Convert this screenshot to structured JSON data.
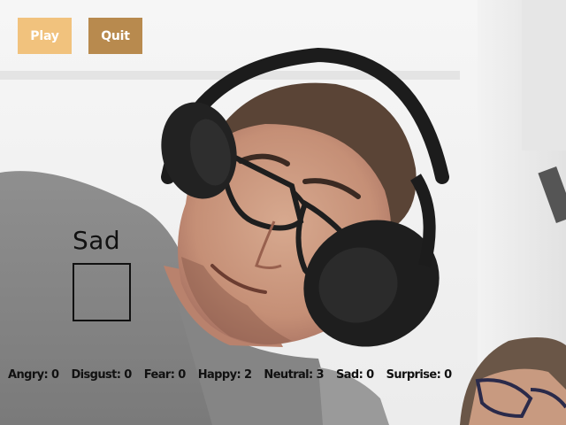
{
  "toolbar": {
    "play_label": "Play",
    "quit_label": "Quit",
    "play_color": "#f1c27d",
    "quit_color": "#b88a4e"
  },
  "detection": {
    "emotion_label": "Sad"
  },
  "stats": [
    {
      "label": "Angry: 0"
    },
    {
      "label": "Disgust: 0"
    },
    {
      "label": "Fear: 0"
    },
    {
      "label": "Happy: 2"
    },
    {
      "label": "Neutral: 3"
    },
    {
      "label": "Sad: 0"
    },
    {
      "label": "Surprise: 0"
    }
  ]
}
